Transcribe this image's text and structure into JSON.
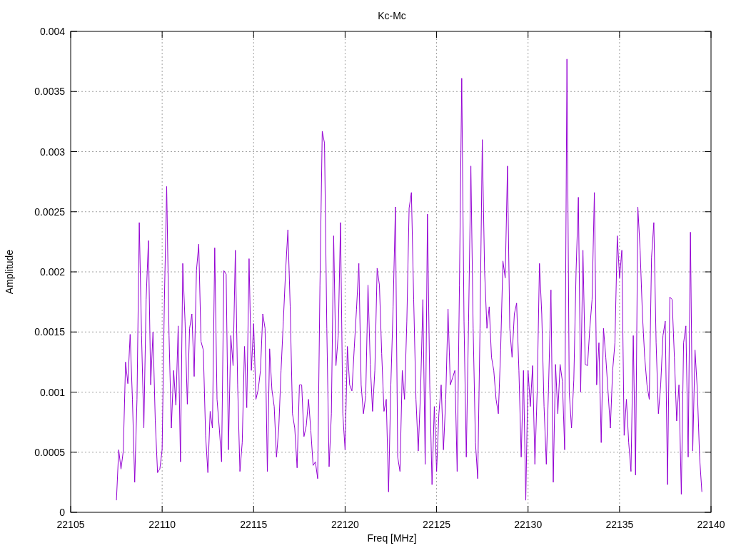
{
  "chart": {
    "chart_data": {
      "type": "line",
      "title": "Kc-Mc",
      "xlabel": "Freq [MHz]",
      "ylabel": "Amplitude",
      "xlim": [
        22105,
        22140
      ],
      "ylim": [
        0,
        0.004
      ],
      "grid": true,
      "xticks": [
        22105,
        22110,
        22115,
        22120,
        22125,
        22130,
        22135,
        22140
      ],
      "yticks": [
        0,
        0.0005,
        0.001,
        0.0015,
        0.002,
        0.0025,
        0.003,
        0.0035,
        0.004
      ],
      "x": [
        22107.5,
        22107.625,
        22107.75,
        22107.875,
        22108,
        22108.125,
        22108.25,
        22108.375,
        22108.5,
        22108.625,
        22108.75,
        22108.875,
        22109,
        22109.125,
        22109.25,
        22109.375,
        22109.5,
        22109.625,
        22109.75,
        22109.875,
        22110,
        22110.125,
        22110.25,
        22110.375,
        22110.5,
        22110.625,
        22110.75,
        22110.875,
        22111,
        22111.125,
        22111.25,
        22111.375,
        22111.5,
        22111.625,
        22111.75,
        22111.875,
        22112,
        22112.125,
        22112.25,
        22112.375,
        22112.5,
        22112.625,
        22112.75,
        22112.875,
        22113,
        22113.125,
        22113.25,
        22113.375,
        22113.5,
        22113.625,
        22113.75,
        22113.875,
        22114,
        22114.125,
        22114.25,
        22114.375,
        22114.5,
        22114.625,
        22114.75,
        22114.875,
        22115,
        22115.125,
        22115.25,
        22115.375,
        22115.5,
        22115.625,
        22115.75,
        22115.875,
        22116,
        22116.125,
        22116.25,
        22116.375,
        22116.5,
        22116.625,
        22116.75,
        22116.875,
        22117,
        22117.125,
        22117.25,
        22117.375,
        22117.5,
        22117.625,
        22117.75,
        22117.875,
        22118,
        22118.125,
        22118.25,
        22118.375,
        22118.5,
        22118.625,
        22118.75,
        22118.875,
        22119,
        22119.125,
        22119.25,
        22119.375,
        22119.5,
        22119.625,
        22119.75,
        22119.875,
        22120,
        22120.125,
        22120.25,
        22120.375,
        22120.5,
        22120.625,
        22120.75,
        22120.875,
        22121,
        22121.125,
        22121.25,
        22121.375,
        22121.5,
        22121.625,
        22121.75,
        22121.875,
        22122,
        22122.125,
        22122.25,
        22122.375,
        22122.5,
        22122.625,
        22122.75,
        22122.875,
        22123,
        22123.125,
        22123.25,
        22123.375,
        22123.5,
        22123.625,
        22123.75,
        22123.875,
        22124,
        22124.125,
        22124.25,
        22124.375,
        22124.5,
        22124.625,
        22124.75,
        22124.875,
        22125,
        22125.125,
        22125.25,
        22125.375,
        22125.5,
        22125.625,
        22125.75,
        22125.875,
        22126,
        22126.125,
        22126.25,
        22126.375,
        22126.5,
        22126.625,
        22126.75,
        22126.875,
        22127,
        22127.125,
        22127.25,
        22127.375,
        22127.5,
        22127.625,
        22127.75,
        22127.875,
        22128,
        22128.125,
        22128.25,
        22128.375,
        22128.5,
        22128.625,
        22128.75,
        22128.875,
        22129,
        22129.125,
        22129.25,
        22129.375,
        22129.5,
        22129.625,
        22129.75,
        22129.875,
        22130,
        22130.125,
        22130.25,
        22130.375,
        22130.5,
        22130.625,
        22130.75,
        22130.875,
        22131,
        22131.125,
        22131.25,
        22131.375,
        22131.5,
        22131.625,
        22131.75,
        22131.875,
        22132,
        22132.125,
        22132.25,
        22132.375,
        22132.5,
        22132.625,
        22132.75,
        22132.875,
        22133,
        22133.125,
        22133.25,
        22133.375,
        22133.5,
        22133.625,
        22133.75,
        22133.875,
        22134,
        22134.125,
        22134.25,
        22134.375,
        22134.5,
        22134.625,
        22134.75,
        22134.875,
        22135,
        22135.125,
        22135.25,
        22135.375,
        22135.5,
        22135.625,
        22135.75,
        22135.875,
        22136,
        22136.125,
        22136.25,
        22136.375,
        22136.5,
        22136.625,
        22136.75,
        22136.875,
        22137,
        22137.125,
        22137.25,
        22137.375,
        22137.5,
        22137.625,
        22137.75,
        22137.875,
        22138,
        22138.125,
        22138.25,
        22138.375,
        22138.5,
        22138.625,
        22138.75,
        22138.875,
        22139,
        22139.125,
        22139.25,
        22139.375,
        22139.5
      ],
      "series": [
        {
          "color": "#9400d3",
          "values": [
            0.0001,
            0.00052,
            0.00036,
            0.00051,
            0.00125,
            0.00107,
            0.00148,
            0.00094,
            0.00025,
            0.00094,
            0.00241,
            0.00147,
            0.0007,
            0.00177,
            0.00226,
            0.00106,
            0.0015,
            0.00076,
            0.00033,
            0.00036,
            0.00052,
            0.00177,
            0.00271,
            0.00147,
            0.0007,
            0.00118,
            0.00089,
            0.00155,
            0.00042,
            0.00207,
            0.00159,
            0.0009,
            0.00153,
            0.00165,
            0.00113,
            0.00201,
            0.00223,
            0.00142,
            0.00135,
            0.00064,
            0.00033,
            0.00084,
            0.0007,
            0.0022,
            0.00094,
            0.0007,
            0.00042,
            0.00201,
            0.00198,
            0.00052,
            0.00147,
            0.00122,
            0.00218,
            0.00106,
            0.00034,
            0.00058,
            0.00138,
            0.00087,
            0.00211,
            0.00118,
            0.00157,
            0.00094,
            0.00102,
            0.00118,
            0.00165,
            0.00153,
            0.00034,
            0.00136,
            0.00102,
            0.00088,
            0.00046,
            0.0007,
            0.00118,
            0.00159,
            0.00201,
            0.00235,
            0.00171,
            0.00082,
            0.0007,
            0.00037,
            0.00106,
            0.00106,
            0.00063,
            0.00072,
            0.00094,
            0.00068,
            0.00039,
            0.00042,
            0.00028,
            0.00189,
            0.00317,
            0.00307,
            0.00153,
            0.00038,
            0.00082,
            0.0023,
            0.00122,
            0.00147,
            0.00241,
            0.00082,
            0.00052,
            0.00138,
            0.00106,
            0.00101,
            0.00136,
            0.00169,
            0.00207,
            0.00106,
            0.00082,
            0.00097,
            0.00189,
            0.00123,
            0.00084,
            0.00118,
            0.00203,
            0.00189,
            0.00132,
            0.00084,
            0.00094,
            0.00017,
            0.00106,
            0.00171,
            0.00254,
            0.00046,
            0.00034,
            0.00118,
            0.00094,
            0.00159,
            0.00253,
            0.00266,
            0.00177,
            0.00094,
            0.00051,
            0.001,
            0.00177,
            0.0004,
            0.00248,
            0.00106,
            0.00023,
            0.00088,
            0.00034,
            0.00082,
            0.00106,
            0.00052,
            0.00094,
            0.00169,
            0.00106,
            0.00112,
            0.00118,
            0.00034,
            0.00189,
            0.00361,
            0.00159,
            0.00046,
            0.00159,
            0.00288,
            0.00153,
            0.00058,
            0.00028,
            0.00153,
            0.0031,
            0.00201,
            0.00153,
            0.00171,
            0.00129,
            0.00118,
            0.00094,
            0.00082,
            0.00135,
            0.00209,
            0.00195,
            0.00288,
            0.00153,
            0.00129,
            0.00165,
            0.00174,
            0.00118,
            0.00046,
            0.00118,
            0.0001,
            0.00118,
            0.00088,
            0.00122,
            0.0004,
            0.00101,
            0.00207,
            0.00165,
            0.00088,
            0.0004,
            0.00106,
            0.00185,
            0.00025,
            0.00123,
            0.00082,
            0.00123,
            0.00109,
            0.00052,
            0.00377,
            0.001,
            0.0007,
            0.0011,
            0.00201,
            0.00262,
            0.001,
            0.00218,
            0.00123,
            0.00122,
            0.00153,
            0.00177,
            0.00266,
            0.00106,
            0.00141,
            0.00058,
            0.00153,
            0.00129,
            0.001,
            0.0007,
            0.00118,
            0.00141,
            0.0023,
            0.00195,
            0.00218,
            0.00064,
            0.00094,
            0.00058,
            0.00034,
            0.00147,
            0.00031,
            0.00254,
            0.00218,
            0.00165,
            0.00129,
            0.00106,
            0.00094,
            0.00212,
            0.00241,
            0.00141,
            0.00082,
            0.00106,
            0.00147,
            0.00159,
            0.00023,
            0.00179,
            0.00177,
            0.00129,
            0.00076,
            0.00106,
            0.00015,
            0.00141,
            0.00155,
            0.00046,
            0.00233,
            0.00051,
            0.00135,
            0.00102,
            0.00046,
            0.00017
          ]
        }
      ]
    }
  }
}
